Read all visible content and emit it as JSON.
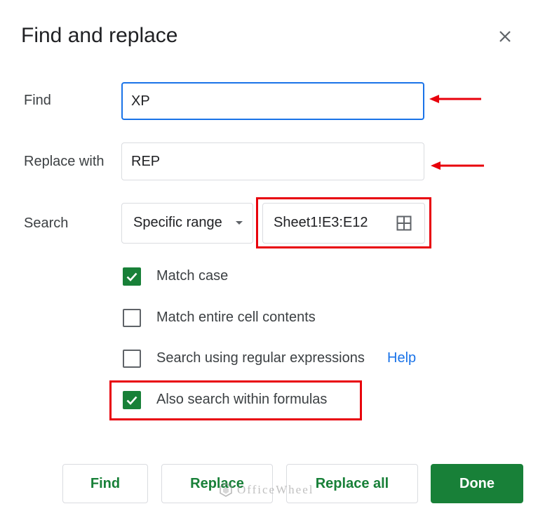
{
  "dialog": {
    "title": "Find and replace",
    "close_icon": "close-icon"
  },
  "find": {
    "label": "Find",
    "value": "XP"
  },
  "replace": {
    "label": "Replace with",
    "value": "REP"
  },
  "search": {
    "label": "Search",
    "scope_selected": "Specific range",
    "range_value": "Sheet1!E3:E12",
    "range_icon": "grid-icon"
  },
  "options": [
    {
      "label": "Match case",
      "checked": true
    },
    {
      "label": "Match entire cell contents",
      "checked": false
    },
    {
      "label": "Search using regular expressions",
      "checked": false
    },
    {
      "label": "Also search within formulas",
      "checked": true
    }
  ],
  "help_link": "Help",
  "buttons": {
    "find": "Find",
    "replace": "Replace",
    "replace_all": "Replace all",
    "done": "Done"
  },
  "watermark": "OfficeWheel",
  "colors": {
    "accent_green": "#188038",
    "focus_blue": "#1a73e8",
    "annotation_red": "#e8000b"
  }
}
